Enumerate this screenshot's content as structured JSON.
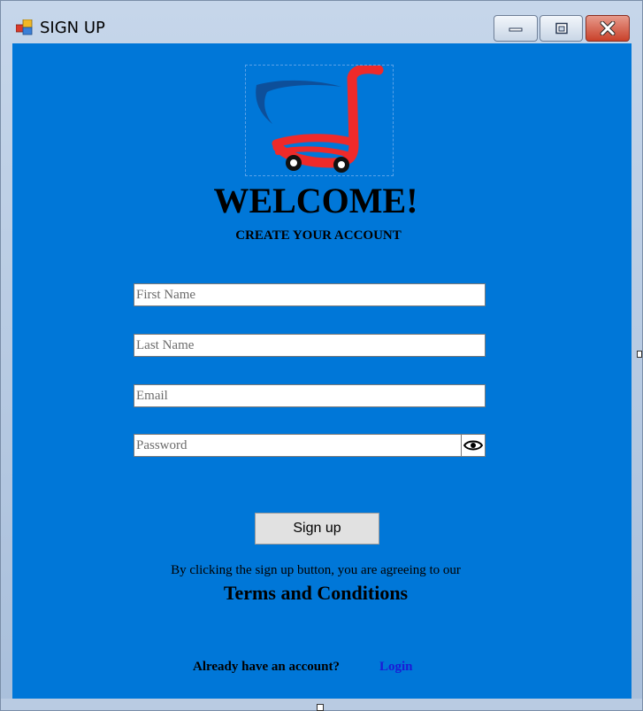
{
  "window": {
    "title": "SIGN UP",
    "controls": {
      "minimize": "minimize",
      "maximize": "maximize",
      "close": "close"
    }
  },
  "header": {
    "welcome": "WELCOME!",
    "subtitle": "CREATE YOUR ACCOUNT"
  },
  "form": {
    "first_name": {
      "placeholder": "First Name",
      "value": ""
    },
    "last_name": {
      "placeholder": "Last Name",
      "value": ""
    },
    "email": {
      "placeholder": "Email",
      "value": ""
    },
    "password": {
      "placeholder": "Password",
      "value": ""
    },
    "show_password_icon": "eye-icon",
    "submit_label": "Sign up"
  },
  "footer": {
    "terms_note": "By clicking the sign up button, you are agreeing to our",
    "terms_link": "Terms and Conditions",
    "have_account": "Already have an account?",
    "login_link": "Login"
  },
  "colors": {
    "background": "#0077d8",
    "cart_red": "#ef2a2a",
    "cart_blue": "#0d4f9a",
    "login_link": "#1b1bd6"
  }
}
